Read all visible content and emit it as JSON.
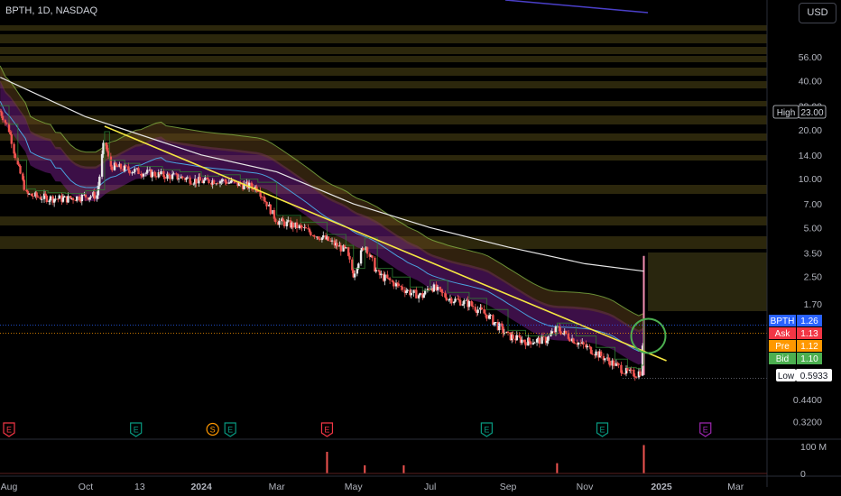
{
  "header": {
    "symbol_line": "BPTH, 1D, NASDAQ",
    "currency_button": "USD"
  },
  "chart_data": {
    "type": "candlestick",
    "symbol": "BPTH",
    "interval": "1D",
    "exchange": "NASDAQ",
    "y_scale": "log",
    "ylim": [
      0.26,
      90
    ],
    "y_tick_labels": [
      "56.00",
      "40.00",
      "28.00",
      "20.00",
      "14.00",
      "10.00",
      "7.00",
      "5.00",
      "3.50",
      "2.50",
      "1.70",
      "0.4400",
      "0.3200"
    ],
    "y_tick_values": [
      56,
      40,
      28,
      20,
      14,
      10,
      7,
      5,
      3.5,
      2.5,
      1.7,
      0.44,
      0.32
    ],
    "x_tick_labels": [
      "Aug",
      "Oct",
      "13",
      "2024",
      "Mar",
      "May",
      "Jul",
      "Sep",
      "Nov",
      "2025",
      "Mar"
    ],
    "x_tick_dates": [
      "2023-08-01",
      "2023-10-01",
      "2023-11-13",
      "2024-01-01",
      "2024-03-01",
      "2024-05-01",
      "2024-07-01",
      "2024-09-01",
      "2024-11-01",
      "2025-01-01",
      "2025-03-01"
    ],
    "price_close": [
      [
        "2023-07-25",
        26
      ],
      [
        "2023-08-01",
        20
      ],
      [
        "2023-08-08",
        12
      ],
      [
        "2023-08-15",
        8
      ],
      [
        "2023-08-22",
        7.8
      ],
      [
        "2023-09-01",
        7.6
      ],
      [
        "2023-09-15",
        7.5
      ],
      [
        "2023-10-01",
        7.8
      ],
      [
        "2023-10-10",
        7.9
      ],
      [
        "2023-10-16",
        18
      ],
      [
        "2023-10-20",
        12
      ],
      [
        "2023-11-01",
        11.5
      ],
      [
        "2023-11-13",
        11
      ],
      [
        "2023-12-01",
        10.5
      ],
      [
        "2023-12-15",
        10.2
      ],
      [
        "2024-01-01",
        9.6
      ],
      [
        "2024-01-15",
        9.8
      ],
      [
        "2024-02-01",
        9.2
      ],
      [
        "2024-02-15",
        8.8
      ],
      [
        "2024-03-01",
        5.5
      ],
      [
        "2024-03-20",
        5.0
      ],
      [
        "2024-04-10",
        4.2
      ],
      [
        "2024-04-25",
        3.6
      ],
      [
        "2024-05-01",
        2.6
      ],
      [
        "2024-05-10",
        4.0
      ],
      [
        "2024-05-20",
        2.6
      ],
      [
        "2024-06-01",
        2.3
      ],
      [
        "2024-06-15",
        2.0
      ],
      [
        "2024-06-25",
        1.9
      ],
      [
        "2024-07-01",
        2.2
      ],
      [
        "2024-07-15",
        1.85
      ],
      [
        "2024-08-01",
        1.7
      ],
      [
        "2024-08-15",
        1.45
      ],
      [
        "2024-09-01",
        1.08
      ],
      [
        "2024-09-15",
        1.0
      ],
      [
        "2024-10-01",
        1.02
      ],
      [
        "2024-10-10",
        1.2
      ],
      [
        "2024-10-25",
        1.0
      ],
      [
        "2024-11-10",
        0.85
      ],
      [
        "2024-11-25",
        0.72
      ],
      [
        "2024-12-05",
        0.64
      ],
      [
        "2024-12-12",
        0.63
      ],
      [
        "2024-12-16",
        0.66
      ],
      [
        "2024-12-18",
        1.26
      ]
    ],
    "ma_slow": [
      [
        "2023-07-25",
        42
      ],
      [
        "2023-10-01",
        24
      ],
      [
        "2024-01-01",
        14
      ],
      [
        "2024-03-01",
        11
      ],
      [
        "2024-05-01",
        7
      ],
      [
        "2024-07-01",
        5
      ],
      [
        "2024-09-01",
        3.8
      ],
      [
        "2024-11-01",
        3.0
      ],
      [
        "2024-12-18",
        2.7
      ]
    ],
    "trendline": [
      [
        "2023-10-16",
        21
      ],
      [
        "2025-01-05",
        0.76
      ]
    ],
    "high_label": "High",
    "high_value": "23.00",
    "low_label": "Low",
    "low_value": "0.5933",
    "quotes": [
      {
        "label": "BPTH",
        "value": "1.26",
        "color": "#2962ff"
      },
      {
        "label": "Ask",
        "value": "1.13",
        "color": "#f23645"
      },
      {
        "label": "Pre",
        "value": "1.12",
        "color": "#ff9800"
      },
      {
        "label": "Bid",
        "value": "1.10",
        "color": "#4caf50"
      }
    ],
    "events": [
      {
        "date": "2023-08-01",
        "label": "E",
        "color": "#f23645"
      },
      {
        "date": "2023-11-10",
        "label": "E",
        "color": "#089981"
      },
      {
        "date": "2024-01-10",
        "label": "S",
        "color": "#ff9800"
      },
      {
        "date": "2024-01-24",
        "label": "E",
        "color": "#089981"
      },
      {
        "date": "2024-04-10",
        "label": "E",
        "color": "#f23645"
      },
      {
        "date": "2024-08-15",
        "label": "E",
        "color": "#089981"
      },
      {
        "date": "2024-11-15",
        "label": "E",
        "color": "#089981"
      },
      {
        "date": "2025-02-05",
        "label": "E",
        "color": "#9c27b0"
      }
    ],
    "volume_axis_labels": [
      "100 M",
      "0"
    ],
    "volume_axis_values": [
      100,
      0
    ],
    "volume_spikes_millions": [
      [
        "2024-04-10",
        80
      ],
      [
        "2024-05-10",
        30
      ],
      [
        "2024-06-10",
        30
      ],
      [
        "2024-10-10",
        38
      ],
      [
        "2024-12-18",
        105
      ]
    ],
    "colors": {
      "up": "#26a69a",
      "down": "#ef5350",
      "candle_fill": "#e8e8e8",
      "trend": "#f5e642",
      "ma_slow": "#e6e6e6",
      "ribbon": "#8e24aa",
      "circle": "#4caf50"
    }
  }
}
